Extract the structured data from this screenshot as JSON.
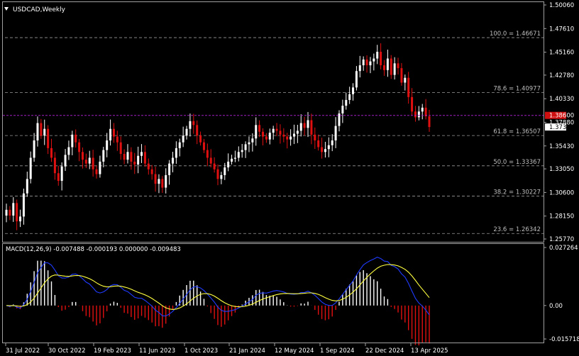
{
  "title": "USDCAD,Weekly",
  "colors": {
    "background": "#000000",
    "bull": "#ffffff",
    "bear": "#e01010",
    "fib_line": "#9a9a9a",
    "current_line": "#a020c0",
    "current_tag_bg": "#d01010",
    "macd_line": "#1f3bff",
    "signal_line": "#ffff40",
    "hist_pos": "#ffffff",
    "hist_neg": "#e01010",
    "frame": "#a0a0a0"
  },
  "price_axis": {
    "min": 1.2577,
    "max": 1.5006,
    "ticks": [
      "1.50060",
      "1.47610",
      "1.45160",
      "1.42780",
      "1.40330",
      "1.37880",
      "1.35430",
      "1.33050",
      "1.30600",
      "1.28150",
      "1.25770"
    ]
  },
  "current": {
    "price_label": "1.38600",
    "price": 1.386,
    "close_label": "1.37393",
    "close": 1.37393
  },
  "fib_levels": [
    {
      "label": "100.0 = 1.46671",
      "price": 1.46671
    },
    {
      "label": "78.6 = 1.40977",
      "price": 1.40977
    },
    {
      "label": "61.8 = 1.36507",
      "price": 1.36507
    },
    {
      "label": "50.0 = 1.33367",
      "price": 1.33367
    },
    {
      "label": "38.2 = 1.30227",
      "price": 1.30227
    },
    {
      "label": "23.6 = 1.26342",
      "price": 1.26342
    }
  ],
  "macd": {
    "label": "MACD(12,26,9) -0.007488 -0.000193 0.000000 -0.009483",
    "axis_min": -0.015718,
    "axis_max": 0.027264,
    "ticks": [
      "0.027264",
      "0.00",
      "-0.015718"
    ]
  },
  "x_labels": [
    "31 Jul 2022",
    "30 Oct 2022",
    "19 Feb 2023",
    "11 Jun 2023",
    "1 Oct 2023",
    "21 Jan 2024",
    "12 May 2024",
    "1 Sep 2024",
    "22 Dec 2024",
    "13 Apr 2025"
  ],
  "chart_data": {
    "type": "candlestick",
    "title": "USDCAD,Weekly",
    "ylim": [
      1.2577,
      1.5006
    ],
    "grid": false,
    "closes": [
      1.288,
      1.282,
      1.295,
      1.276,
      1.281,
      1.305,
      1.32,
      1.342,
      1.36,
      1.378,
      1.365,
      1.372,
      1.352,
      1.342,
      1.326,
      1.318,
      1.333,
      1.345,
      1.353,
      1.366,
      1.358,
      1.348,
      1.34,
      1.336,
      1.342,
      1.33,
      1.325,
      1.338,
      1.35,
      1.36,
      1.372,
      1.364,
      1.358,
      1.346,
      1.34,
      1.348,
      1.338,
      1.335,
      1.344,
      1.348,
      1.336,
      1.33,
      1.325,
      1.315,
      1.32,
      1.311,
      1.324,
      1.336,
      1.342,
      1.352,
      1.358,
      1.365,
      1.372,
      1.38,
      1.376,
      1.365,
      1.358,
      1.35,
      1.342,
      1.336,
      1.33,
      1.32,
      1.324,
      1.332,
      1.338,
      1.341,
      1.342,
      1.348,
      1.35,
      1.356,
      1.358,
      1.362,
      1.376,
      1.369,
      1.364,
      1.361,
      1.368,
      1.372,
      1.37,
      1.366,
      1.364,
      1.361,
      1.364,
      1.367,
      1.37,
      1.378,
      1.373,
      1.381,
      1.366,
      1.36,
      1.353,
      1.348,
      1.351,
      1.355,
      1.36,
      1.375,
      1.388,
      1.396,
      1.402,
      1.408,
      1.415,
      1.432,
      1.438,
      1.444,
      1.438,
      1.442,
      1.445,
      1.452,
      1.438,
      1.433,
      1.445,
      1.428,
      1.44,
      1.435,
      1.42,
      1.425,
      1.405,
      1.39,
      1.384,
      1.39,
      1.394,
      1.385,
      1.37393
    ],
    "x_labels": [
      "31 Jul 2022",
      "30 Oct 2022",
      "19 Feb 2023",
      "11 Jun 2023",
      "1 Oct 2023",
      "21 Jan 2024",
      "12 May 2024",
      "1 Sep 2024",
      "22 Dec 2024",
      "13 Apr 2025"
    ],
    "fib_levels": [
      1.46671,
      1.40977,
      1.36507,
      1.33367,
      1.30227,
      1.26342
    ],
    "macd": {
      "fast": 12,
      "slow": 26,
      "signal": 9,
      "ylim": [
        -0.015718,
        0.027264
      ]
    }
  }
}
